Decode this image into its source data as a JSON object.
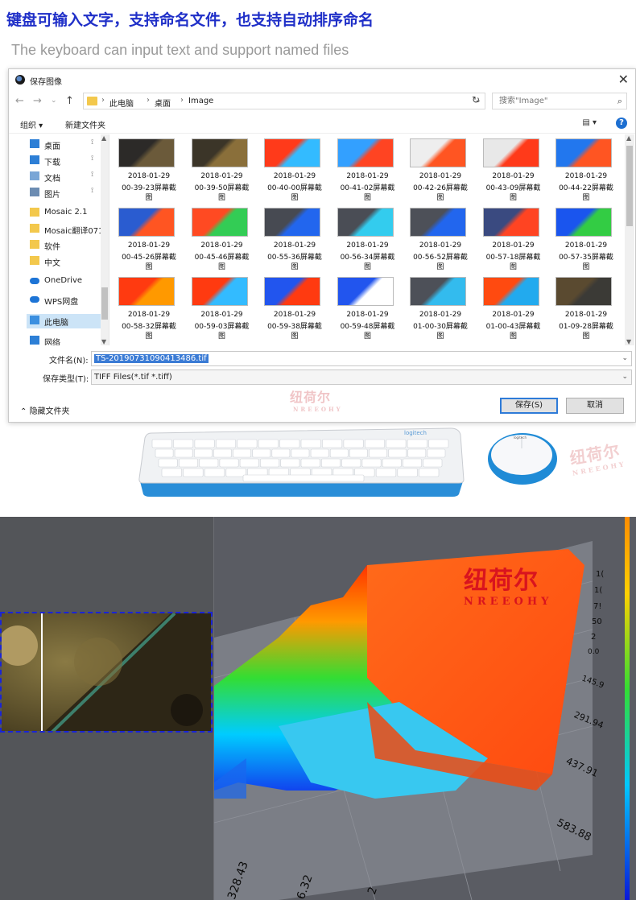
{
  "hero": {
    "title": "键盘可输入文字，支持命名文件，也支持自动排序命名",
    "subtitle": "The keyboard can input text and support named files"
  },
  "dialog": {
    "title": "保存图像",
    "breadcrumb": [
      "此电脑",
      "桌面",
      "Image"
    ],
    "search_placeholder": "搜索\"Image\"",
    "toolbar": {
      "organize": "组织 ▾",
      "new_folder": "新建文件夹"
    },
    "sidebar": [
      {
        "label": "桌面",
        "icon": "desktop-icon",
        "pinned": true
      },
      {
        "label": "下载",
        "icon": "download-icon",
        "pinned": true
      },
      {
        "label": "文档",
        "icon": "document-icon",
        "pinned": true
      },
      {
        "label": "图片",
        "icon": "picture-icon",
        "pinned": true
      },
      {
        "label": "Mosaic 2.1",
        "icon": "folder-icon",
        "pinned": false
      },
      {
        "label": "Mosaic翻译071",
        "icon": "folder-icon",
        "pinned": false
      },
      {
        "label": "软件",
        "icon": "folder-icon",
        "pinned": false
      },
      {
        "label": "中文",
        "icon": "folder-icon",
        "pinned": false
      },
      {
        "label": "OneDrive",
        "icon": "cloud-icon",
        "pinned": false
      },
      {
        "label": "WPS网盘",
        "icon": "cloud-icon",
        "pinned": false
      },
      {
        "label": "此电脑",
        "icon": "computer-icon",
        "pinned": false
      },
      {
        "label": "网络",
        "icon": "network-icon",
        "pinned": false
      }
    ],
    "files": [
      {
        "date": "2018-01-29",
        "time": "00-39-23屏幕截",
        "suffix": "图"
      },
      {
        "date": "2018-01-29",
        "time": "00-39-50屏幕截",
        "suffix": "图"
      },
      {
        "date": "2018-01-29",
        "time": "00-40-00屏幕截",
        "suffix": "图"
      },
      {
        "date": "2018-01-29",
        "time": "00-41-02屏幕截",
        "suffix": "图"
      },
      {
        "date": "2018-01-29",
        "time": "00-42-26屏幕截",
        "suffix": "图"
      },
      {
        "date": "2018-01-29",
        "time": "00-43-09屏幕截",
        "suffix": "图"
      },
      {
        "date": "2018-01-29",
        "time": "00-44-22屏幕截",
        "suffix": "图"
      },
      {
        "date": "2018-01-29",
        "time": "00-45-26屏幕截",
        "suffix": "图"
      },
      {
        "date": "2018-01-29",
        "time": "00-45-46屏幕截",
        "suffix": "图"
      },
      {
        "date": "2018-01-29",
        "time": "00-55-36屏幕截",
        "suffix": "图"
      },
      {
        "date": "2018-01-29",
        "time": "00-56-34屏幕截",
        "suffix": "图"
      },
      {
        "date": "2018-01-29",
        "time": "00-56-52屏幕截",
        "suffix": "图"
      },
      {
        "date": "2018-01-29",
        "time": "00-57-18屏幕截",
        "suffix": "图"
      },
      {
        "date": "2018-01-29",
        "time": "00-57-35屏幕截",
        "suffix": "图"
      },
      {
        "date": "2018-01-29",
        "time": "00-58-32屏幕截",
        "suffix": "图"
      },
      {
        "date": "2018-01-29",
        "time": "00-59-03屏幕截",
        "suffix": "图"
      },
      {
        "date": "2018-01-29",
        "time": "00-59-38屏幕截",
        "suffix": "图"
      },
      {
        "date": "2018-01-29",
        "time": "00-59-48屏幕截",
        "suffix": "图"
      },
      {
        "date": "2018-01-29",
        "time": "01-00-30屏幕截",
        "suffix": "图"
      },
      {
        "date": "2018-01-29",
        "time": "01-00-43屏幕截",
        "suffix": "图"
      },
      {
        "date": "2018-01-29",
        "time": "01-09-28屏幕截",
        "suffix": "图"
      }
    ],
    "filename_label": "文件名(N):",
    "filename_value": "TS-20190731090413486.tif",
    "filetype_label": "保存类型(T):",
    "filetype_value": "TIFF Files(*.tif *.tiff)",
    "hide_folders": "隐藏文件夹",
    "save_button": "保存(S)",
    "cancel_button": "取消"
  },
  "watermark": {
    "cn": "纽荷尔",
    "en": "NREEOHY"
  },
  "keyboard_brand": "logitech",
  "viz": {
    "right_ticks": [
      "1(",
      "1(",
      "7!",
      "50",
      "2",
      "0.0",
      "145.9",
      "291.94",
      "437.91",
      "583.88"
    ],
    "bottom_ticks": [
      "328.43",
      "6.32",
      "2"
    ]
  },
  "colors": {
    "title_blue": "#1f2fc8",
    "accent_blue": "#2e7bd8",
    "watermark_red": "#d9141e"
  }
}
